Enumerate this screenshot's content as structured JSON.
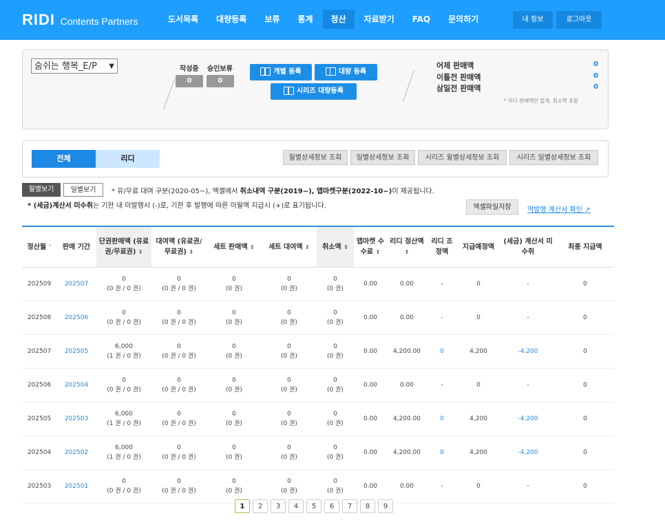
{
  "header": {
    "brand": "RIDI",
    "subtitle": "Contents Partners",
    "nav": [
      "도서목록",
      "대량등록",
      "보류",
      "통계",
      "정산",
      "자료받기",
      "FAQ",
      "문의하기"
    ],
    "active_nav": "정산",
    "my_info": "내 정보",
    "logout": "로그아웃"
  },
  "summary": {
    "book_select": "숨쉬는 행복_E/P",
    "writing_label": "작성중",
    "writing_count": "0",
    "hold_label": "승인보류",
    "hold_count": "0",
    "single_register": "개별 등록",
    "bulk_register": "대량 등록",
    "series_bulk_register": "시리즈 대량등록",
    "sales": [
      {
        "label": "어제 판매액",
        "value": "0"
      },
      {
        "label": "이틀전 판매액",
        "value": "0"
      },
      {
        "label": "삼일전 판매액",
        "value": "0"
      }
    ],
    "sales_note": "* 리디 판매액만 집계, 취소액 포함"
  },
  "tabs": {
    "all": "전체",
    "ridi": "리디",
    "buttons": [
      "월별상세정보 조회",
      "일별상세정보 조회",
      "시리즈 월별상세정보 조회",
      "시리즈 일별상세정보 조회"
    ]
  },
  "view": {
    "monthly": "월별보기",
    "daily": "일별보기",
    "note1_prefix": "* 유/무료 대여 구분(2020-05~), 엑셀에서 ",
    "note1_bold": "취소내역 구분(2019~), 앱마켓구분(2022-10~)",
    "note1_suffix": "이 제공됩니다.",
    "note2_bold": "* (세금)계산서 미수취",
    "note2_rest": "는 기한 내 미발행시 (-)로, 기한 후 발행에 따른 이월액 지급시 (+)로 표기됩니다.",
    "excel_save": "엑셀파일저장",
    "reverse_issue_link": "역발행 계산서 확인"
  },
  "table": {
    "headers": [
      {
        "text": "정산월",
        "sort": "˅"
      },
      {
        "text": "판매 기간",
        "sort": ""
      },
      {
        "text": "단권판매액 (유료권/무료권)",
        "sort": "⇕"
      },
      {
        "text": "대여액 (유료권/무료권)",
        "sort": "⇕"
      },
      {
        "text": "세트 판매액",
        "sort": "⇕"
      },
      {
        "text": "세트 대여액",
        "sort": "⇕"
      },
      {
        "text": "취소액",
        "sort": "⇕"
      },
      {
        "text": "앱마켓 수수료",
        "sort": "⇕"
      },
      {
        "text": "리디 정산액",
        "sort": "⇕"
      },
      {
        "text": "리디 조정액",
        "sort": ""
      },
      {
        "text": "지급예정액",
        "sort": ""
      },
      {
        "text": "(세금) 계산서 미수취",
        "sort": ""
      },
      {
        "text": "최종 지급액",
        "sort": ""
      }
    ],
    "rows": [
      {
        "month": "202509",
        "period": "202507",
        "single": "0",
        "single_sub": "(0 권 / 0 권)",
        "rent": "0",
        "rent_sub": "(0 권 / 0 권)",
        "set_sale": "0",
        "set_sale_sub": "(0 권)",
        "set_rent": "0",
        "set_rent_sub": "(0 권)",
        "cancel": "0",
        "cancel_sub": "(0 권)",
        "app_fee": "0.00",
        "ridi_settle": "0.00",
        "adjust": "-",
        "scheduled": "0",
        "tax_unreceived": "-",
        "final": "0"
      },
      {
        "month": "202508",
        "period": "202506",
        "single": "0",
        "single_sub": "(0 권 / 0 권)",
        "rent": "0",
        "rent_sub": "(0 권 / 0 권)",
        "set_sale": "0",
        "set_sale_sub": "(0 권)",
        "set_rent": "0",
        "set_rent_sub": "(0 권)",
        "cancel": "0",
        "cancel_sub": "(0 권)",
        "app_fee": "0.00",
        "ridi_settle": "0.00",
        "adjust": "-",
        "scheduled": "0",
        "tax_unreceived": "-",
        "final": "0"
      },
      {
        "month": "202507",
        "period": "202505",
        "single": "6,000",
        "single_sub": "(1 권 / 0 권)",
        "rent": "0",
        "rent_sub": "(0 권 / 0 권)",
        "set_sale": "0",
        "set_sale_sub": "(0 권)",
        "set_rent": "0",
        "set_rent_sub": "(0 권)",
        "cancel": "0",
        "cancel_sub": "(0 권)",
        "app_fee": "0.00",
        "ridi_settle": "4,200.00",
        "adjust": "0",
        "scheduled": "4,200",
        "tax_unreceived": "-4,200",
        "final": "0"
      },
      {
        "month": "202506",
        "period": "202504",
        "single": "0",
        "single_sub": "(0 권 / 0 권)",
        "rent": "0",
        "rent_sub": "(0 권 / 0 권)",
        "set_sale": "0",
        "set_sale_sub": "(0 권)",
        "set_rent": "0",
        "set_rent_sub": "(0 권)",
        "cancel": "0",
        "cancel_sub": "(0 권)",
        "app_fee": "0.00",
        "ridi_settle": "0.00",
        "adjust": "-",
        "scheduled": "0",
        "tax_unreceived": "-",
        "final": "0"
      },
      {
        "month": "202505",
        "period": "202503",
        "single": "6,000",
        "single_sub": "(1 권 / 0 권)",
        "rent": "0",
        "rent_sub": "(0 권 / 0 권)",
        "set_sale": "0",
        "set_sale_sub": "(0 권)",
        "set_rent": "0",
        "set_rent_sub": "(0 권)",
        "cancel": "0",
        "cancel_sub": "(0 권)",
        "app_fee": "0.00",
        "ridi_settle": "4,200.00",
        "adjust": "0",
        "scheduled": "4,200",
        "tax_unreceived": "-4,200",
        "final": "0"
      },
      {
        "month": "202504",
        "period": "202502",
        "single": "6,000",
        "single_sub": "(1 권 / 0 권)",
        "rent": "0",
        "rent_sub": "(0 권 / 0 권)",
        "set_sale": "0",
        "set_sale_sub": "(0 권)",
        "set_rent": "0",
        "set_rent_sub": "(0 권)",
        "cancel": "0",
        "cancel_sub": "(0 권)",
        "app_fee": "0.00",
        "ridi_settle": "4,200.00",
        "adjust": "0",
        "scheduled": "4,200",
        "tax_unreceived": "-4,200",
        "final": "0"
      },
      {
        "month": "202503",
        "period": "202501",
        "single": "0",
        "single_sub": "(0 권 / 0 권)",
        "rent": "0",
        "rent_sub": "(0 권 / 0 권)",
        "set_sale": "0",
        "set_sale_sub": "(0 권)",
        "set_rent": "0",
        "set_rent_sub": "(0 권)",
        "cancel": "0",
        "cancel_sub": "(0 권)",
        "app_fee": "0.00",
        "ridi_settle": "0.00",
        "adjust": "-",
        "scheduled": "0",
        "tax_unreceived": "-",
        "final": "0"
      }
    ]
  },
  "pagination": {
    "pages": [
      "1",
      "2",
      "3",
      "4",
      "5",
      "6",
      "7",
      "8",
      "9"
    ],
    "current": "1"
  },
  "colors": {
    "brand_blue": "#1e9eff",
    "link_blue": "#1e88e5",
    "tab_active": "#1e88e5",
    "tab_inactive": "#cce6ff"
  }
}
